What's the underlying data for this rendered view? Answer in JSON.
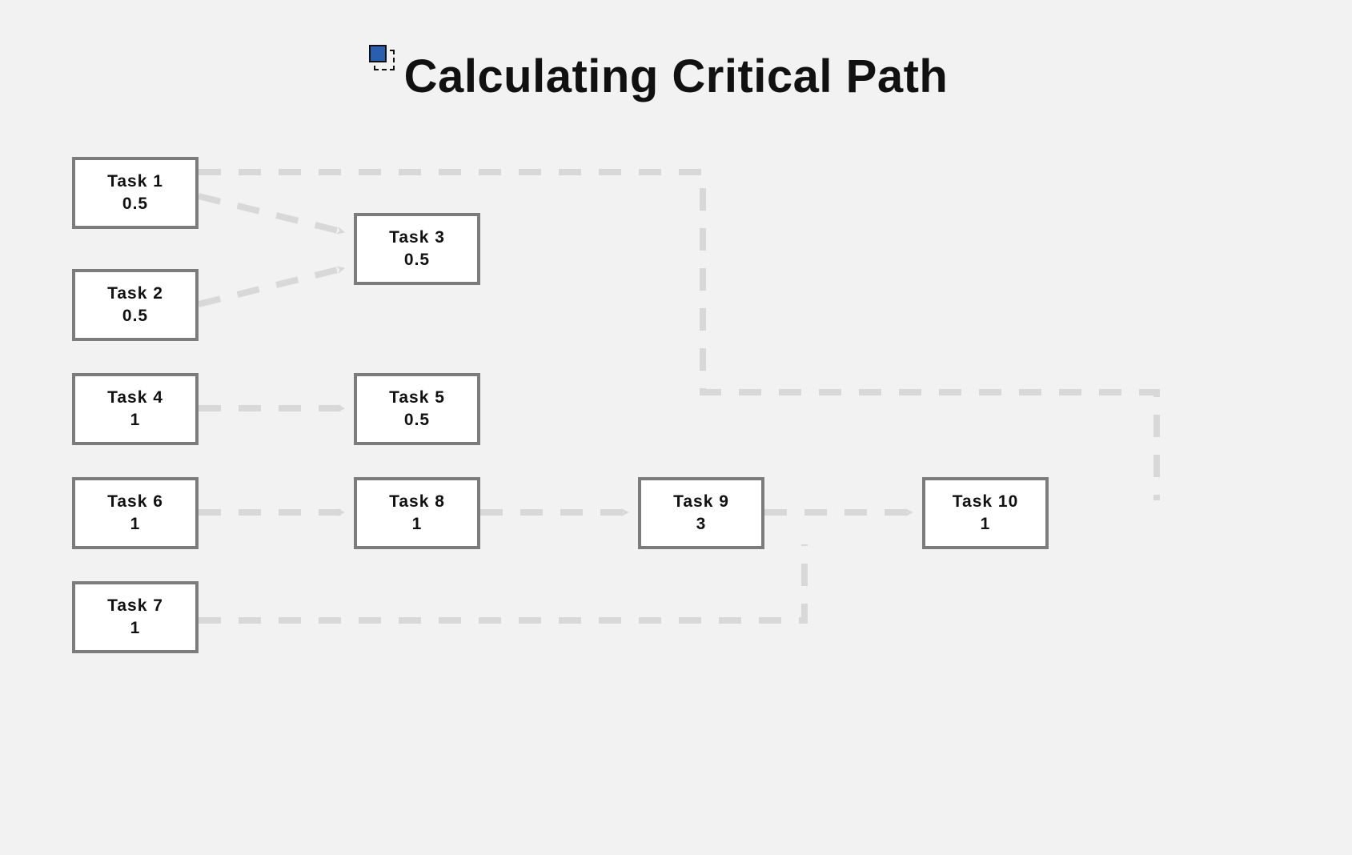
{
  "title": "Calculating Critical Path",
  "tasks": {
    "t1": {
      "name": "Task 1",
      "value": "0.5"
    },
    "t2": {
      "name": "Task 2",
      "value": "0.5"
    },
    "t3": {
      "name": "Task 3",
      "value": "0.5"
    },
    "t4": {
      "name": "Task 4",
      "value": "1"
    },
    "t5": {
      "name": "Task 5",
      "value": "0.5"
    },
    "t6": {
      "name": "Task 6",
      "value": "1"
    },
    "t7": {
      "name": "Task 7",
      "value": "1"
    },
    "t8": {
      "name": "Task 8",
      "value": "1"
    },
    "t9": {
      "name": "Task 9",
      "value": "3"
    },
    "t10": {
      "name": "Task 10",
      "value": "1"
    }
  }
}
